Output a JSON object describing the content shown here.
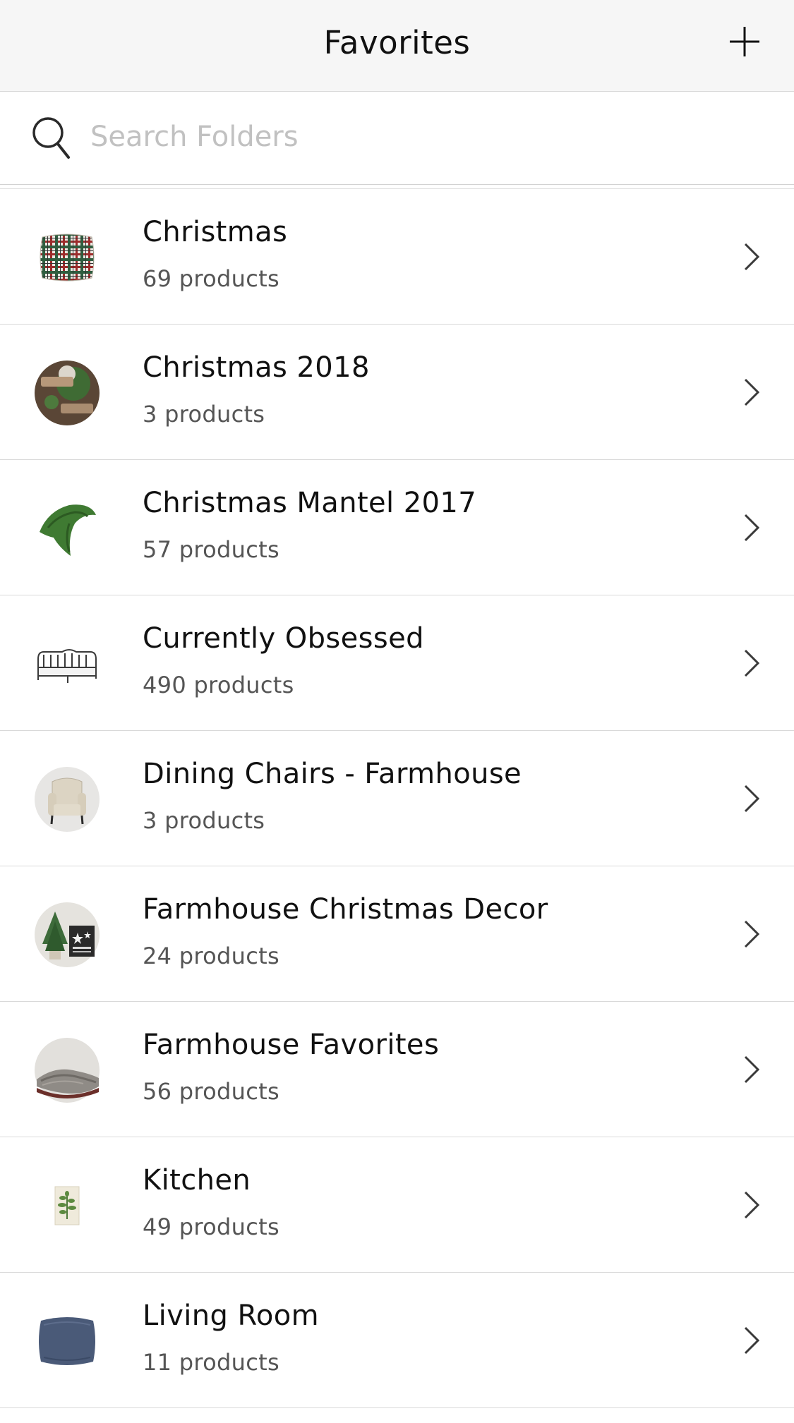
{
  "header": {
    "title": "Favorites"
  },
  "search": {
    "placeholder": "Search Folders",
    "value": ""
  },
  "folders": [
    {
      "name": "Christmas",
      "count": "69 products",
      "thumbnail": "plaid-pillow"
    },
    {
      "name": "Christmas 2018",
      "count": "3 products",
      "thumbnail": "mom-dad-wreath-sign"
    },
    {
      "name": "Christmas Mantel 2017",
      "count": "57 products",
      "thumbnail": "greenery-garland"
    },
    {
      "name": "Currently Obsessed",
      "count": "490 products",
      "thumbnail": "metal-bed-frame"
    },
    {
      "name": "Dining Chairs - Farmhouse",
      "count": "3 products",
      "thumbnail": "upholstered-chair"
    },
    {
      "name": "Farmhouse Christmas Decor",
      "count": "24 products",
      "thumbnail": "tree-and-star-sign"
    },
    {
      "name": "Farmhouse Favorites",
      "count": "56 products",
      "thumbnail": "knit-throw-blanket"
    },
    {
      "name": "Kitchen",
      "count": "49 products",
      "thumbnail": "botanical-print"
    },
    {
      "name": "Living Room",
      "count": "11 products",
      "thumbnail": "blue-pillow"
    }
  ]
}
